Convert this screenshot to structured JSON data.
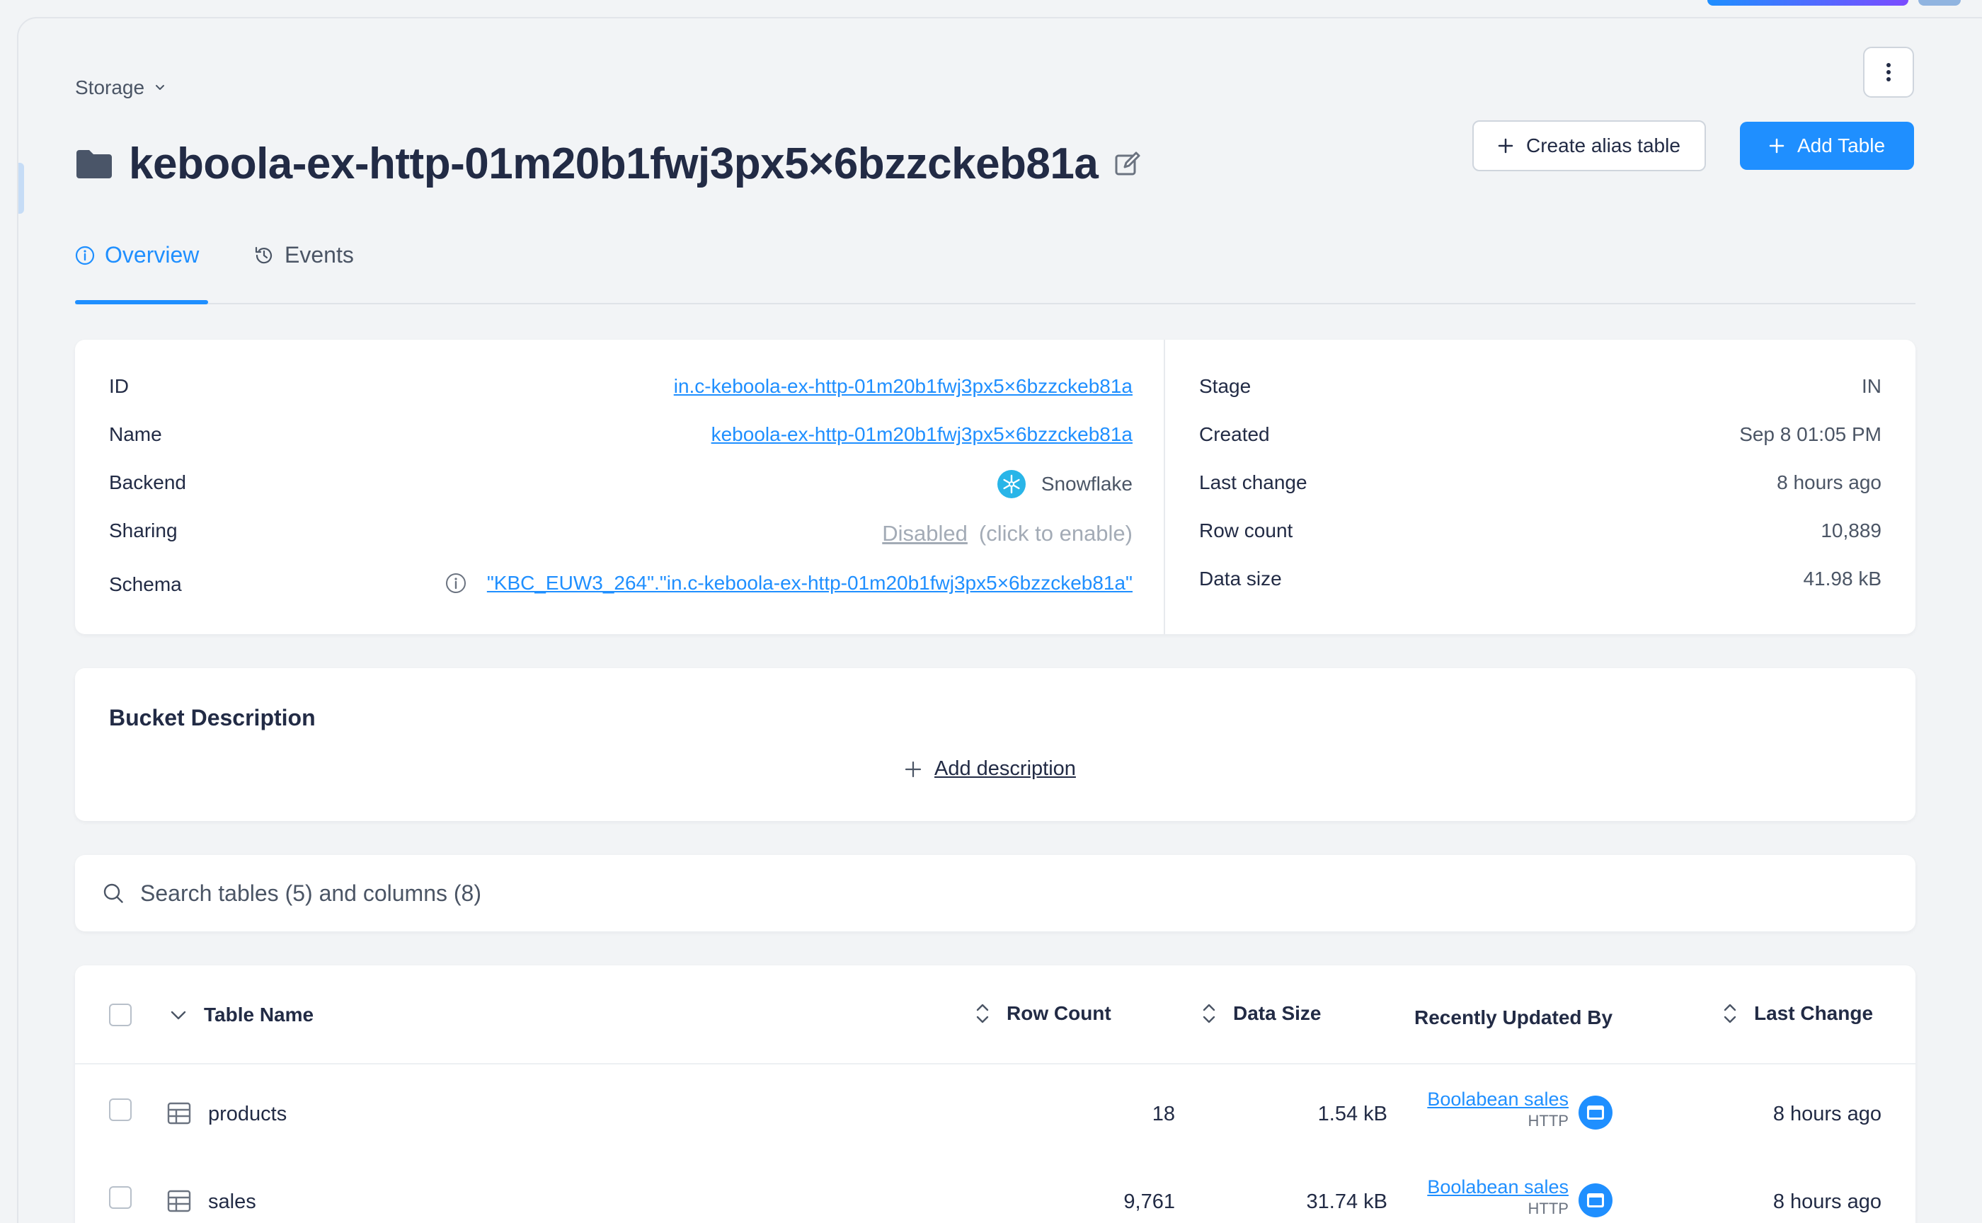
{
  "breadcrumb": {
    "label": "Storage"
  },
  "bucket": {
    "title": "keboola-ex-http-01m20b1fwj3px5×6bzzckeb81a"
  },
  "actions": {
    "create_alias": "Create alias table",
    "add_table": "Add Table"
  },
  "tabs": [
    {
      "label": "Overview",
      "active": true
    },
    {
      "label": "Events",
      "active": false
    }
  ],
  "info_left": {
    "id_label": "ID",
    "id_value": "in.c-keboola-ex-http-01m20b1fwj3px5×6bzzckeb81a",
    "name_label": "Name",
    "name_value": "keboola-ex-http-01m20b1fwj3px5×6bzzckeb81a",
    "backend_label": "Backend",
    "backend_value": "Snowflake",
    "sharing_label": "Sharing",
    "sharing_value": "Disabled",
    "sharing_hint": "(click to enable)",
    "schema_label": "Schema",
    "schema_value": "\"KBC_EUW3_264\".\"in.c-keboola-ex-http-01m20b1fwj3px5×6bzzckeb81a\""
  },
  "info_right": {
    "stage_label": "Stage",
    "stage_value": "IN",
    "created_label": "Created",
    "created_value": "Sep 8 01:05 PM",
    "last_change_label": "Last change",
    "last_change_value": "8 hours ago",
    "row_count_label": "Row count",
    "row_count_value": "10,889",
    "data_size_label": "Data size",
    "data_size_value": "41.98 kB"
  },
  "description": {
    "heading": "Bucket Description",
    "add_label": "Add description"
  },
  "search": {
    "placeholder": "Search tables (5) and columns (8)"
  },
  "table": {
    "headers": {
      "name": "Table Name",
      "row_count": "Row Count",
      "data_size": "Data Size",
      "updated_by": "Recently Updated By",
      "last_change": "Last Change"
    },
    "rows": [
      {
        "name": "products",
        "row_count": "18",
        "data_size": "1.54 kB",
        "updated_by": "Boolabean sales",
        "updated_by_type": "HTTP",
        "last_change": "8 hours ago"
      },
      {
        "name": "sales",
        "row_count": "9,761",
        "data_size": "31.74 kB",
        "updated_by": "Boolabean sales",
        "updated_by_type": "HTTP",
        "last_change": "8 hours ago"
      }
    ]
  },
  "colors": {
    "accent": "#1f8fff",
    "text": "#222b45",
    "muted": "#4b5565"
  }
}
